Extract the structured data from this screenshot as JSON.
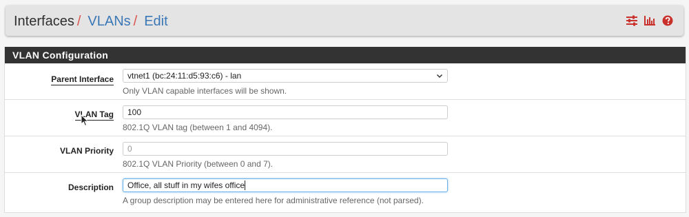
{
  "breadcrumb": {
    "root": "Interfaces",
    "separator": "/",
    "items": [
      "VLANs",
      "Edit"
    ]
  },
  "header_icons": [
    "sliders-icon",
    "bar-chart-icon",
    "help-icon"
  ],
  "colors": {
    "accent_red": "#d9534f",
    "link_blue": "#3a77b6",
    "panel_heading_bg": "#333333",
    "icon_red": "#c9302c"
  },
  "panel": {
    "title": "VLAN Configuration",
    "rows": [
      {
        "label": "Parent Interface",
        "type": "select",
        "value": "vtnet1 (bc:24:11:d5:93:c6) - lan",
        "help": "Only VLAN capable interfaces will be shown."
      },
      {
        "label": "VLAN Tag",
        "type": "input",
        "value": "100",
        "help": "802.1Q VLAN tag (between 1 and 4094)."
      },
      {
        "label": "VLAN Priority",
        "type": "input",
        "placeholder": "0",
        "help": "802.1Q VLAN Priority (between 0 and 7)."
      },
      {
        "label": "Description",
        "type": "input",
        "value": "Office, all stuff in my wifes office",
        "help": "A group description may be entered here for administrative reference (not parsed)."
      }
    ]
  }
}
